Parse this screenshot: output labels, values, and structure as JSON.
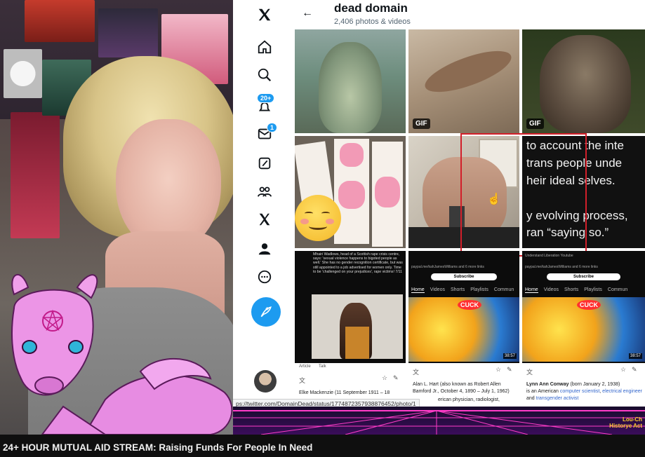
{
  "video": {
    "title": "24+ HOUR MUTUAL AID STREAM: Raising Funds For People In Need"
  },
  "overlay": {
    "corner_label_line1": "Lou-Ch",
    "corner_label_line2": "Historye Act",
    "accent_color": "#e845d8"
  },
  "browser": {
    "status_url": "ps://twitter.com/DomainDead/status/1774872357938876452/photo/1"
  },
  "x_app": {
    "header": {
      "title": "dead domain",
      "subtitle": "2,406 photos & videos"
    },
    "nav": {
      "notifications_badge": "20+",
      "messages_badge": "1",
      "items": [
        "x-logo-icon",
        "home-icon",
        "search-icon",
        "notifications-icon",
        "messages-icon",
        "lists-icon",
        "communities-icon",
        "premium-icon",
        "profile-icon",
        "more-icon"
      ]
    },
    "media": {
      "gif_label": "GIF",
      "quote_lines": [
        "to account the inte",
        "trans people unde",
        "heir ideal selves.",
        "y evolving process,",
        "ran “saying so.”"
      ],
      "tweet_card": {
        "caption": "Mhairi Wadlows, head of a Scottish rape crisis centre, says: 'sexual violence happens to bigoted people as well.' She has no gender recognition certificate, but was still appointed to a job advertised for women only. Time to be 'challenged on your prejudices', rape victims! 7/11",
        "tabs": [
          "Article",
          "Talk"
        ],
        "wiki_line": "Elke Mackenzie (11 September 1911 – 18"
      },
      "yt_card_1": {
        "links": "paypal.me/kahJamesWilliams and 6 more links",
        "subscribe": "Subscribe",
        "tabs": [
          "Home",
          "Videos",
          "Shorts",
          "Playlists",
          "Commun"
        ],
        "duration": "38:57",
        "wiki_line1": "Alan L. Hart (also known as Robert Allen",
        "wiki_line2": "Bamford Jr., October 4, 1890 – July 1, 1962)",
        "wiki_line3": "erican physician, radiologist,"
      },
      "yt_card_2": {
        "header_text": "Understand Liberation Youtube",
        "links": "paypal.me/kahJamesWilliams and 6 more links",
        "subscribe": "Subscribe",
        "tabs": [
          "Home",
          "Videos",
          "Shorts",
          "Playlists",
          "Commun"
        ],
        "duration": "38:57",
        "wiki_name": "Lynn Ann Conway",
        "wiki_rest": " (born January 2, 1938)",
        "wiki_line2_pre": "is an American ",
        "wiki_link1": "computer scientist",
        "wiki_link2": "electrical engineer",
        "wiki_link3": "transgender activist",
        "and_text": " and "
      },
      "comic_bubble": "CUCK"
    }
  }
}
